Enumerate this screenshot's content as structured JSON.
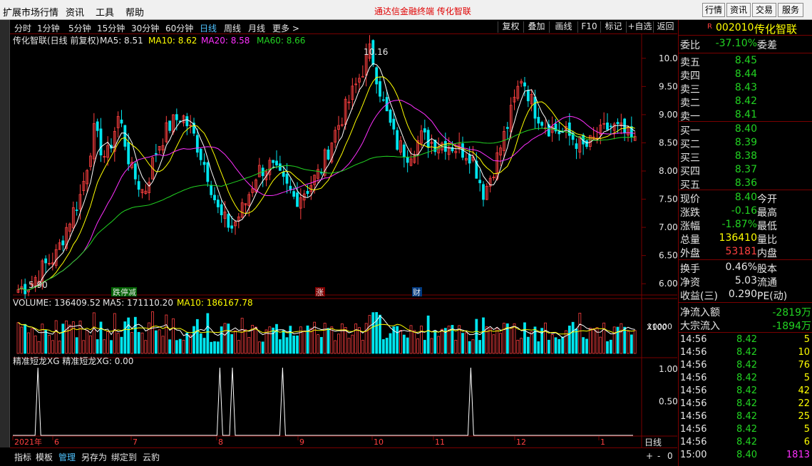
{
  "menubar": {
    "items": [
      "扩展市场行情",
      "资讯",
      "工具",
      "帮助"
    ],
    "center_title": "通达信金融终端  传化智联",
    "right_buttons": [
      "行情",
      "资讯",
      "交易",
      "服务"
    ]
  },
  "periods": {
    "items": [
      "分时",
      "1分钟",
      "5分钟",
      "15分钟",
      "30分钟",
      "60分钟",
      "日线",
      "周线",
      "月线",
      "更多 >"
    ],
    "active": "日线"
  },
  "toolbar": {
    "items": [
      "复权",
      "叠加",
      "画线",
      "F10",
      "标记",
      "+自选",
      "返回"
    ]
  },
  "stock": {
    "code": "002010",
    "name": "传化智联",
    "flag": "R"
  },
  "ma_legend": {
    "title": "传化智联(日线 前复权)",
    "ma5": "MA5: 8.51",
    "ma10": "MA10: 8.62",
    "ma20": "MA20: 8.58",
    "ma60": "MA60: 8.66"
  },
  "vol_legend": {
    "volume": "VOLUME: 136409.52",
    "ma5": "MA5: 171110.20",
    "ma10": "MA10: 186167.78"
  },
  "ind_legend": {
    "text": "精准短龙XG  精准短龙XG: 0.00"
  },
  "price_axis": [
    "10.00",
    "9.50",
    "9.00",
    "8.50",
    "8.00",
    "7.50",
    "7.00",
    "6.50",
    "6.00"
  ],
  "vol_axis": {
    "label": "10000",
    "unit": "X100"
  },
  "ind_axis": [
    "1.00",
    "0.50"
  ],
  "annotations": {
    "high": "10.16",
    "low": "5.90",
    "events": [
      "跌停减",
      "涨",
      "财"
    ]
  },
  "date_axis": [
    "2021年",
    "6",
    "7",
    "8",
    "9",
    "10",
    "11",
    "12",
    "1"
  ],
  "period_label": "日线",
  "bottom_tabs": [
    "指标",
    "模板",
    "管理",
    "另存为",
    "绑定到",
    "云豹"
  ],
  "bottom_active": "管理",
  "bottom_btns": [
    "+",
    "-",
    "0"
  ],
  "chart_data": {
    "type": "candlestick",
    "ohlc_close_path": [
      5.9,
      6.0,
      6.3,
      6.5,
      7.1,
      7.6,
      8.7,
      8.2,
      9.0,
      8.0,
      7.6,
      8.4,
      8.8,
      9.0,
      8.6,
      8.0,
      7.2,
      7.0,
      7.4,
      8.0,
      8.1,
      7.8,
      7.5,
      7.7,
      8.0,
      8.6,
      9.1,
      9.6,
      10.16,
      9.2,
      8.5,
      8.3,
      8.6,
      8.5,
      8.5,
      8.4,
      8.3,
      7.6,
      8.2,
      8.9,
      9.7,
      9.1,
      8.8,
      8.7,
      8.6,
      8.4,
      8.6,
      8.8,
      8.7,
      8.5
    ],
    "ylim": [
      5.8,
      10.2
    ],
    "high": 10.16,
    "low": 5.9,
    "signals": [
      0.04,
      0.33,
      0.35,
      0.43,
      0.73
    ],
    "colors": {
      "up": "#ff4040",
      "down": "#00e5ee",
      "ma5": "#ffffff",
      "ma10": "#ffff00",
      "ma20": "#ff30ff",
      "ma60": "#22d422"
    }
  },
  "quote": {
    "weibi": {
      "label": "委比",
      "value": "-37.10%",
      "label2": "委差"
    },
    "sells": [
      {
        "label": "卖五",
        "price": "8.45"
      },
      {
        "label": "卖四",
        "price": "8.44"
      },
      {
        "label": "卖三",
        "price": "8.43"
      },
      {
        "label": "卖二",
        "price": "8.42"
      },
      {
        "label": "卖一",
        "price": "8.41"
      }
    ],
    "buys": [
      {
        "label": "买一",
        "price": "8.40"
      },
      {
        "label": "买二",
        "price": "8.39"
      },
      {
        "label": "买三",
        "price": "8.38"
      },
      {
        "label": "买四",
        "price": "8.37"
      },
      {
        "label": "买五",
        "price": "8.36"
      }
    ],
    "stats": [
      {
        "label": "现价",
        "value": "8.40",
        "label2": "今开",
        "vc": "g"
      },
      {
        "label": "涨跌",
        "value": "-0.16",
        "label2": "最高",
        "vc": "g"
      },
      {
        "label": "涨幅",
        "value": "-1.87%",
        "label2": "最低",
        "vc": "g"
      },
      {
        "label": "总量",
        "value": "136410",
        "label2": "量比",
        "vc": "y"
      },
      {
        "label": "外盘",
        "value": "53181",
        "label2": "内盘",
        "vc": "r"
      }
    ],
    "stats2": [
      {
        "label": "换手",
        "value": "0.46%",
        "label2": "股本"
      },
      {
        "label": "净资",
        "value": "5.03",
        "label2": "流通"
      },
      {
        "label": "收益(三)",
        "value": "0.290",
        "label2": "PE(动)"
      }
    ],
    "flows": [
      {
        "label": "净流入额",
        "value": "-2819万"
      },
      {
        "label": "大宗流入",
        "value": "-1894万"
      }
    ],
    "ticks": [
      {
        "time": "14:56",
        "price": "8.42",
        "vol": "5",
        "vc": "y"
      },
      {
        "time": "14:56",
        "price": "8.42",
        "vol": "10",
        "vc": "y"
      },
      {
        "time": "14:56",
        "price": "8.42",
        "vol": "76",
        "vc": "y"
      },
      {
        "time": "14:56",
        "price": "8.42",
        "vol": "5",
        "vc": "y"
      },
      {
        "time": "14:56",
        "price": "8.42",
        "vol": "42",
        "vc": "y"
      },
      {
        "time": "14:56",
        "price": "8.42",
        "vol": "22",
        "vc": "y"
      },
      {
        "time": "14:56",
        "price": "8.42",
        "vol": "25",
        "vc": "y"
      },
      {
        "time": "14:56",
        "price": "8.42",
        "vol": "5",
        "vc": "y"
      },
      {
        "time": "14:56",
        "price": "8.42",
        "vol": "6",
        "vc": "y"
      },
      {
        "time": "15:00",
        "price": "8.40",
        "vol": "1813",
        "vc": "m"
      }
    ]
  }
}
